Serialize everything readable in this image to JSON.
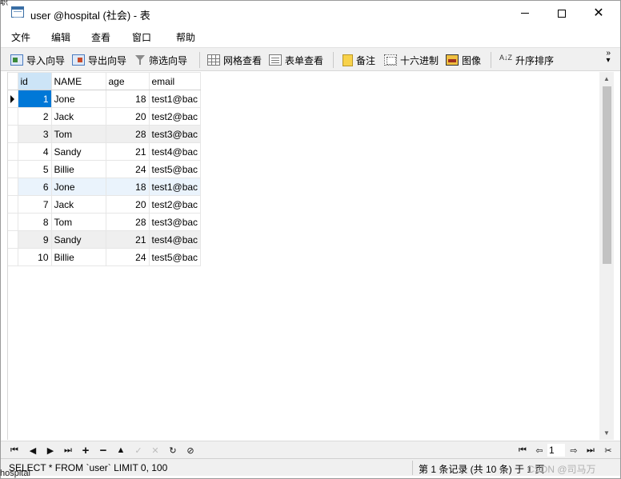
{
  "window": {
    "title": "user @hospital (社会) - 表",
    "minimize": "minimize",
    "maximize": "maximize",
    "close": "close"
  },
  "menu": {
    "items": [
      "文件",
      "编辑",
      "查看",
      "窗口",
      "帮助"
    ]
  },
  "toolbar": {
    "import_wizard": "导入向导",
    "export_wizard": "导出向导",
    "filter_wizard": "筛选向导",
    "grid_view": "网格查看",
    "form_view": "表单查看",
    "memo": "备注",
    "hex": "十六进制",
    "image": "图像",
    "sort_asc": "升序排序",
    "sort_icon_text": "A↓Z"
  },
  "table": {
    "columns": [
      "id",
      "NAME",
      "age",
      "email"
    ],
    "rows": [
      {
        "id": "1",
        "name": "Jone",
        "age": "18",
        "email": "test1@bac"
      },
      {
        "id": "2",
        "name": "Jack",
        "age": "20",
        "email": "test2@bac"
      },
      {
        "id": "3",
        "name": "Tom",
        "age": "28",
        "email": "test3@bac"
      },
      {
        "id": "4",
        "name": "Sandy",
        "age": "21",
        "email": "test4@bac"
      },
      {
        "id": "5",
        "name": "Billie",
        "age": "24",
        "email": "test5@bac"
      },
      {
        "id": "6",
        "name": "Jone",
        "age": "18",
        "email": "test1@bac"
      },
      {
        "id": "7",
        "name": "Jack",
        "age": "20",
        "email": "test2@bac"
      },
      {
        "id": "8",
        "name": "Tom",
        "age": "28",
        "email": "test3@bac"
      },
      {
        "id": "9",
        "name": "Sandy",
        "age": "21",
        "email": "test4@bac"
      },
      {
        "id": "10",
        "name": "Billie",
        "age": "24",
        "email": "test5@bac"
      }
    ]
  },
  "navigation": {
    "current_page": "1"
  },
  "status": {
    "sql": "SELECT * FROM `user` LIMIT 0, 1000",
    "records": "第 1 条记录 (共 10 条) 于 1 页",
    "watermark": "CSDN @司马万"
  },
  "background": {
    "bottom_text": "hospital",
    "top_text": "职"
  },
  "colors": {
    "selection": "#0078d7",
    "column_header_selected": "#cce4f7",
    "alt_row": "#efefef"
  }
}
